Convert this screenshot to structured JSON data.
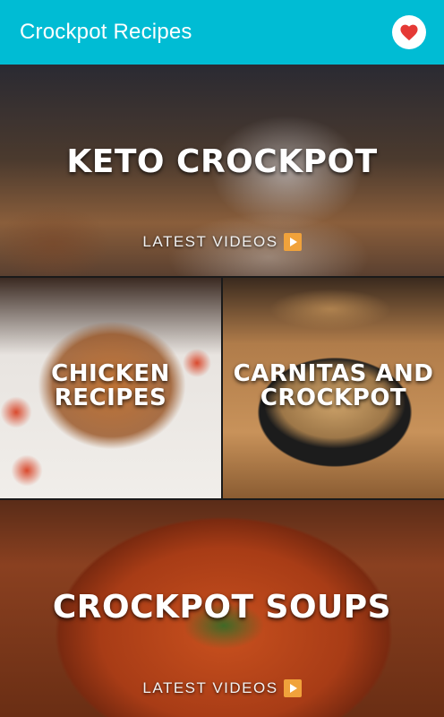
{
  "app": {
    "title": "Crockpot Recipes",
    "accent_color": "#00bcd4",
    "favorite_icon": "heart-icon",
    "favorite_color": "#e53935"
  },
  "tiles": [
    {
      "title": "KETO CROCKPOT",
      "subtitle": "LATEST VIDEOS",
      "subtitle_icon": "play-icon"
    },
    {
      "title": "CHICKEN RECIPES",
      "line1": "CHICKEN",
      "line2": "RECIPES"
    },
    {
      "title": "CARNITAS AND CROCKPOT",
      "line1": "CARNITAS AND",
      "line2": "CROCKPOT"
    },
    {
      "title": "CROCKPOT SOUPS",
      "subtitle": "LATEST VIDEOS",
      "subtitle_icon": "play-icon"
    }
  ]
}
